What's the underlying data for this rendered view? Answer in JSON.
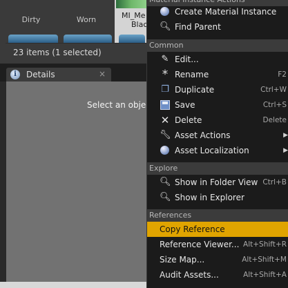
{
  "asset_browser": {
    "assets": [
      {
        "name": "Dirty"
      },
      {
        "name": "Worn"
      },
      {
        "name_line1": "MI_Me",
        "name_line2": "Blac"
      }
    ],
    "status": "23 items (1 selected)"
  },
  "details": {
    "tab_label": "Details",
    "close_glyph": "×",
    "empty_message": "Select an object",
    "icon": "info-icon"
  },
  "menu": {
    "top_section": "Material Instance Actions",
    "top_items": [
      {
        "label": "Create Material Instance",
        "icon": "material-sphere-icon"
      },
      {
        "label": "Find Parent",
        "icon": "magnifier-icon"
      }
    ],
    "common": {
      "title": "Common",
      "items": [
        {
          "label": "Edit...",
          "shortcut": "",
          "icon": "pencil-icon"
        },
        {
          "label": "Rename",
          "shortcut": "F2",
          "icon": "asterisk-icon"
        },
        {
          "label": "Duplicate",
          "shortcut": "Ctrl+W",
          "icon": "duplicate-icon"
        },
        {
          "label": "Save",
          "shortcut": "Ctrl+S",
          "icon": "save-icon"
        },
        {
          "label": "Delete",
          "shortcut": "Delete",
          "icon": "delete-icon"
        },
        {
          "label": "Asset Actions",
          "shortcut": "",
          "icon": "wrench-icon",
          "submenu": true
        },
        {
          "label": "Asset Localization",
          "shortcut": "",
          "icon": "globe-icon",
          "submenu": true
        }
      ]
    },
    "explore": {
      "title": "Explore",
      "items": [
        {
          "label": "Show in Folder View",
          "shortcut": "Ctrl+B",
          "icon": "magnifier-icon"
        },
        {
          "label": "Show in Explorer",
          "shortcut": "",
          "icon": "magnifier-icon"
        }
      ]
    },
    "references": {
      "title": "References",
      "items": [
        {
          "label": "Copy Reference",
          "shortcut": "",
          "highlighted": true
        },
        {
          "label": "Reference Viewer...",
          "shortcut": "Alt+Shift+R"
        },
        {
          "label": "Size Map...",
          "shortcut": "Alt+Shift+M"
        },
        {
          "label": "Audit Assets...",
          "shortcut": "Alt+Shift+A"
        }
      ]
    },
    "submenu_arrow": "▶",
    "highlight_color": "#e0a400"
  }
}
